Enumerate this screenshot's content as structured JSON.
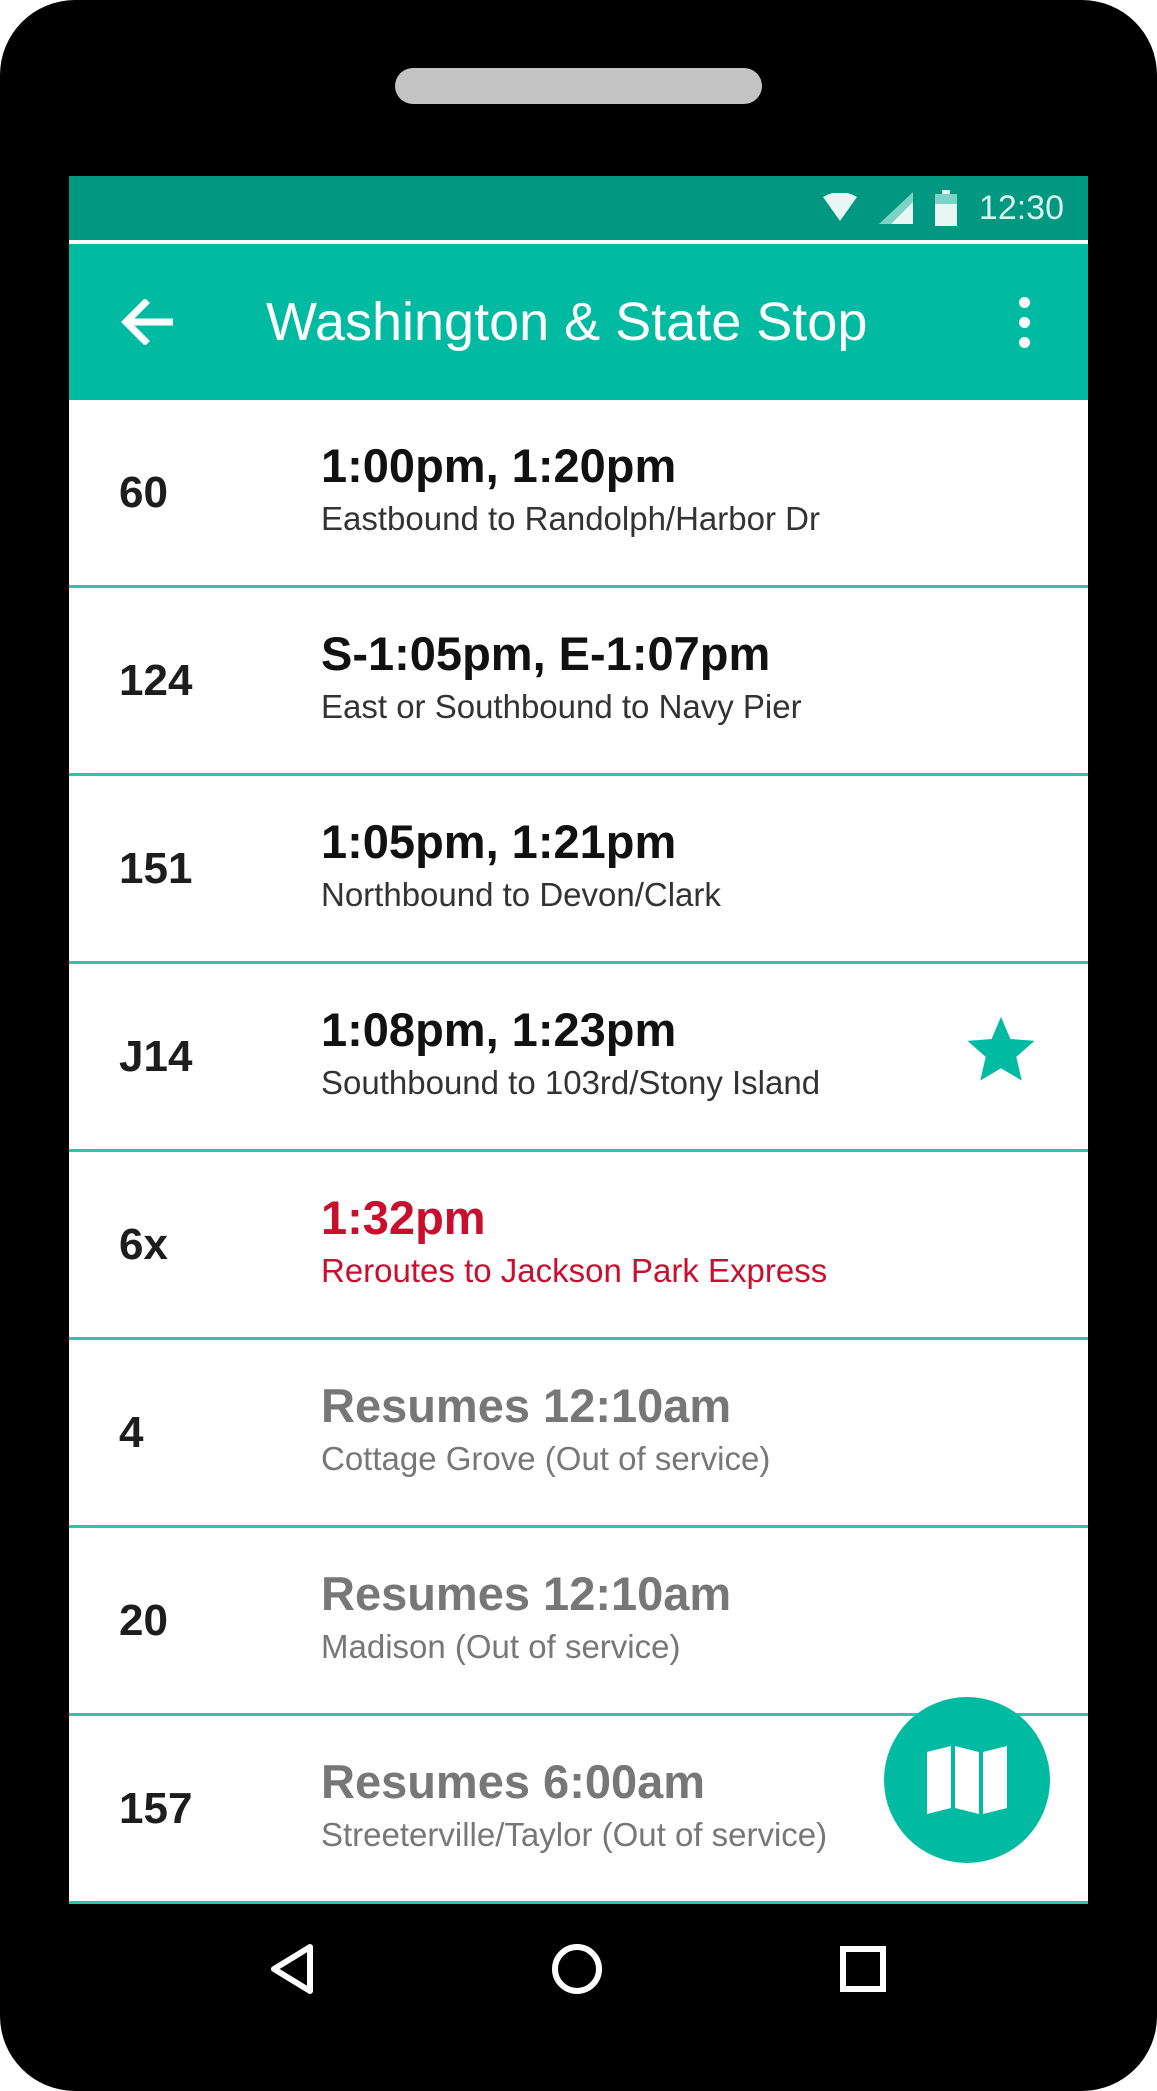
{
  "status_bar": {
    "time": "12:30",
    "icons": [
      "wifi-icon",
      "signal-icon",
      "battery-icon"
    ]
  },
  "app_bar": {
    "title": "Washington & State Stop",
    "back_icon": "arrow-left-icon",
    "menu_icon": "more-vert-icon"
  },
  "colors": {
    "primary": "#00bba2",
    "status_bar": "#009880",
    "divider": "#32c2ac",
    "alert": "#c8102e",
    "inactive": "#777777"
  },
  "routes": [
    {
      "route": "60",
      "times": "1:00pm, 1:20pm",
      "destination": "Eastbound to Randolph/Harbor Dr",
      "state": "normal"
    },
    {
      "route": "124",
      "times": "S-1:05pm, E-1:07pm",
      "destination": "East or Southbound to Navy Pier",
      "state": "normal"
    },
    {
      "route": "151",
      "times": "1:05pm, 1:21pm",
      "destination": "Northbound to Devon/Clark",
      "state": "normal"
    },
    {
      "route": "J14",
      "times": "1:08pm, 1:23pm",
      "destination": "Southbound to 103rd/Stony Island",
      "state": "normal",
      "favorite": true
    },
    {
      "route": "6x",
      "times": "1:32pm",
      "destination": "Reroutes to Jackson Park Express",
      "state": "alert"
    },
    {
      "route": "4",
      "times": "Resumes 12:10am",
      "destination": "Cottage Grove (Out of service)",
      "state": "out"
    },
    {
      "route": "20",
      "times": "Resumes 12:10am",
      "destination": "Madison (Out of service)",
      "state": "out"
    },
    {
      "route": "157",
      "times": "Resumes 6:00am",
      "destination": "Streeterville/Taylor (Out of service)",
      "state": "out"
    }
  ],
  "fab": {
    "icon": "map-icon"
  },
  "nav_bar": {
    "icons": [
      "back-triangle-icon",
      "home-circle-icon",
      "recents-square-icon"
    ]
  }
}
